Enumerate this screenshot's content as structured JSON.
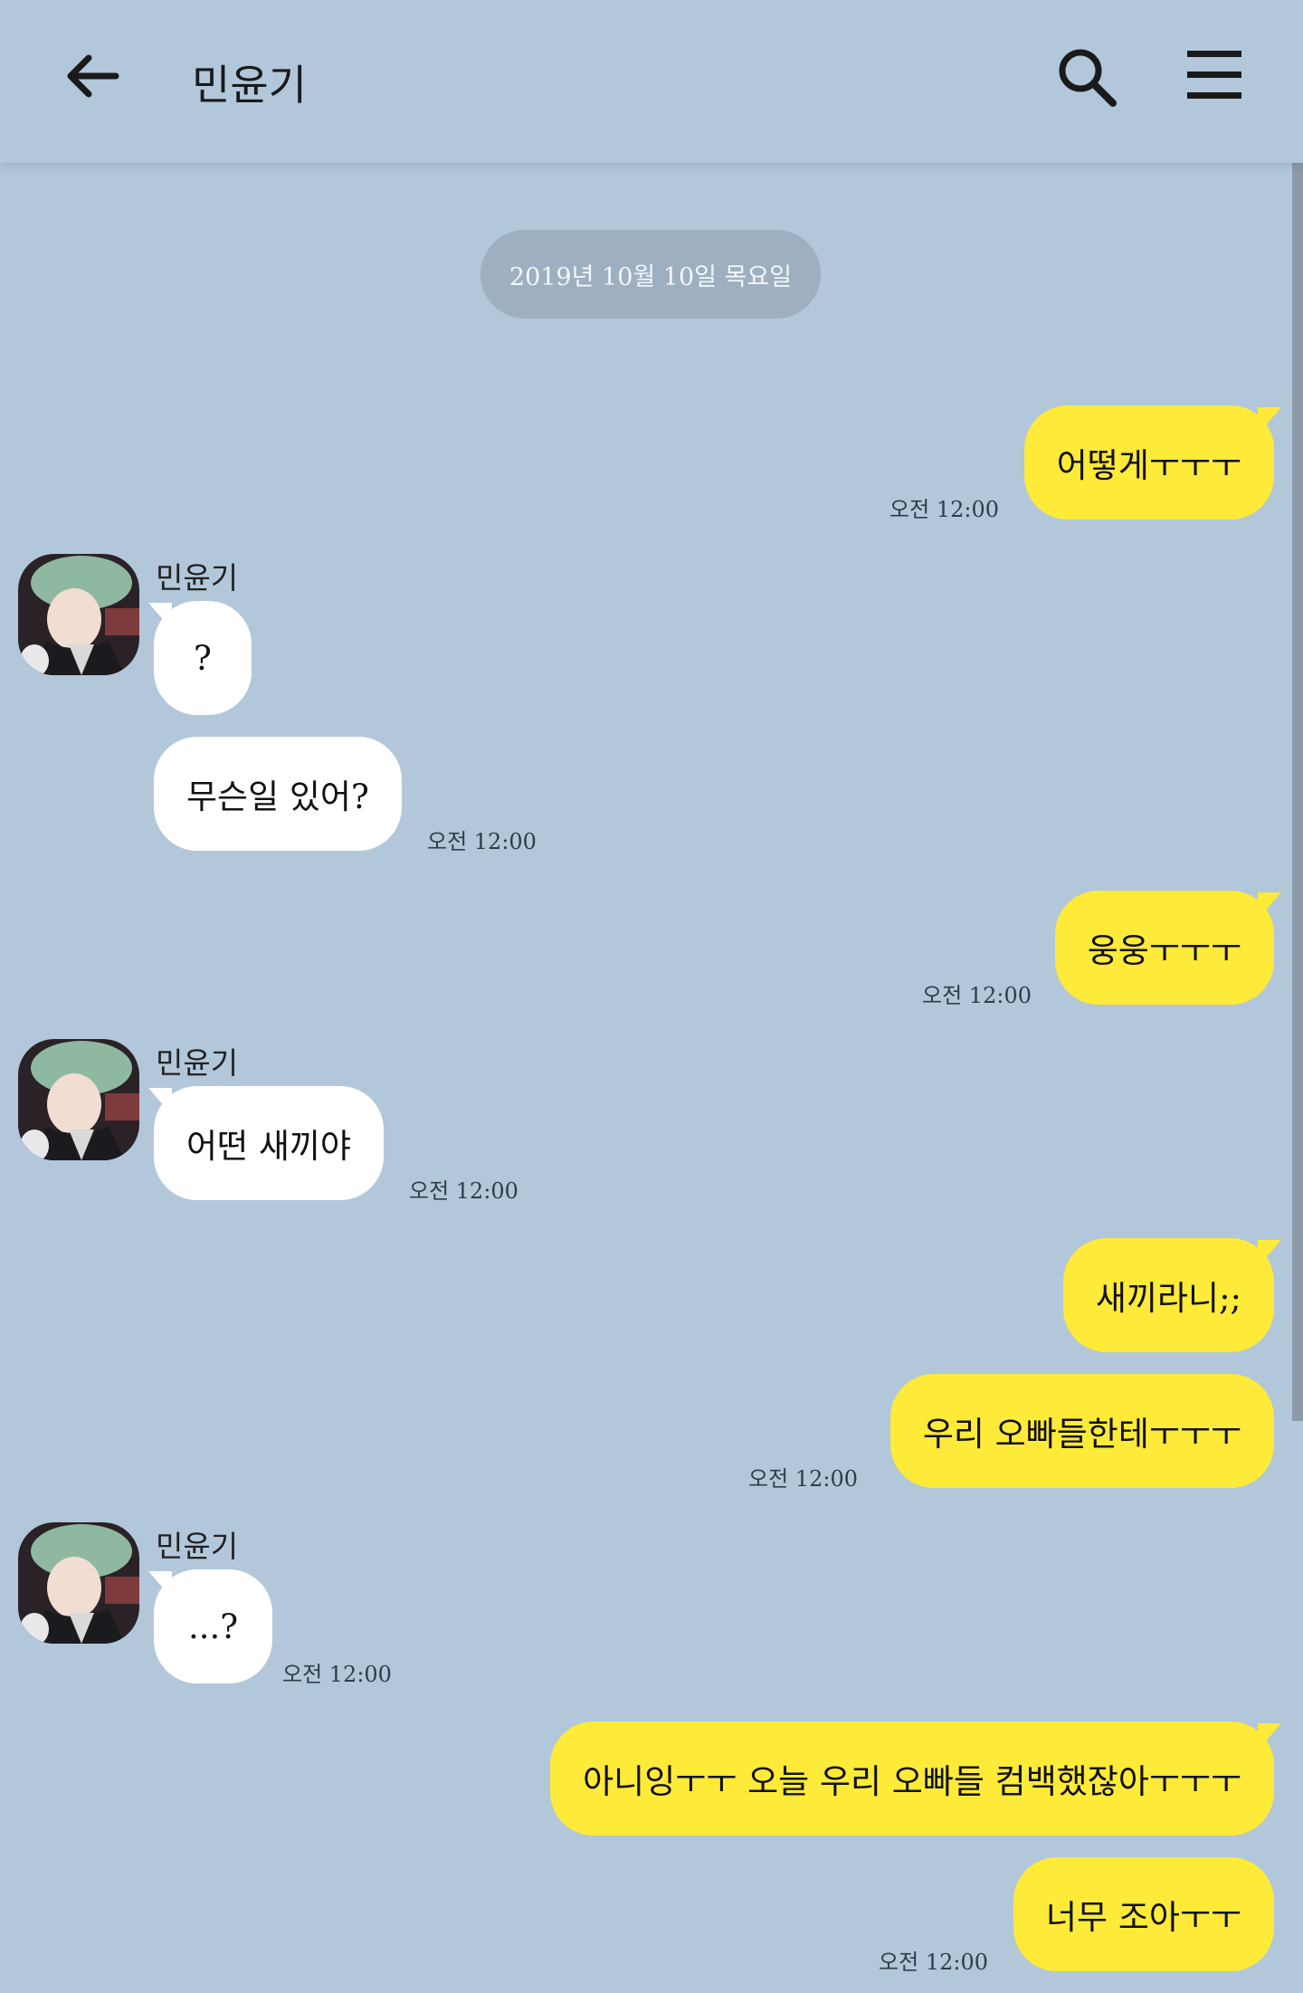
{
  "header": {
    "title": "민윤기"
  },
  "date_divider": "2019년 10월 10일 목요일",
  "messages": [
    {
      "side": "out",
      "text": "어떻게ㅜㅜㅜ",
      "time": "오전 12:00"
    },
    {
      "side": "in",
      "sender": "민윤기",
      "text": "?"
    },
    {
      "side": "in",
      "text": "무슨일 있어?",
      "time": "오전 12:00"
    },
    {
      "side": "out",
      "text": "웅웅ㅜㅜㅜ",
      "time": "오전 12:00"
    },
    {
      "side": "in",
      "sender": "민윤기",
      "text": "어떤 새끼야",
      "time": "오전 12:00"
    },
    {
      "side": "out",
      "text": "새끼라니;;"
    },
    {
      "side": "out",
      "text": "우리 오빠들한테ㅜㅜㅜ",
      "time": "오전 12:00"
    },
    {
      "side": "in",
      "sender": "민윤기",
      "text": "...?",
      "time": "오전 12:00"
    },
    {
      "side": "out",
      "text": "아니잉ㅜㅜ 오늘 우리 오빠들 컴백했잖아ㅜㅜㅜ"
    },
    {
      "side": "out",
      "text": "너무 조아ㅜㅜ",
      "time": "오전 12:00"
    }
  ],
  "colors": {
    "background": "#b2c7da",
    "outgoing_bubble": "#feea38",
    "incoming_bubble": "#ffffff"
  },
  "icons": [
    "back-arrow-icon",
    "search-icon",
    "menu-icon"
  ]
}
